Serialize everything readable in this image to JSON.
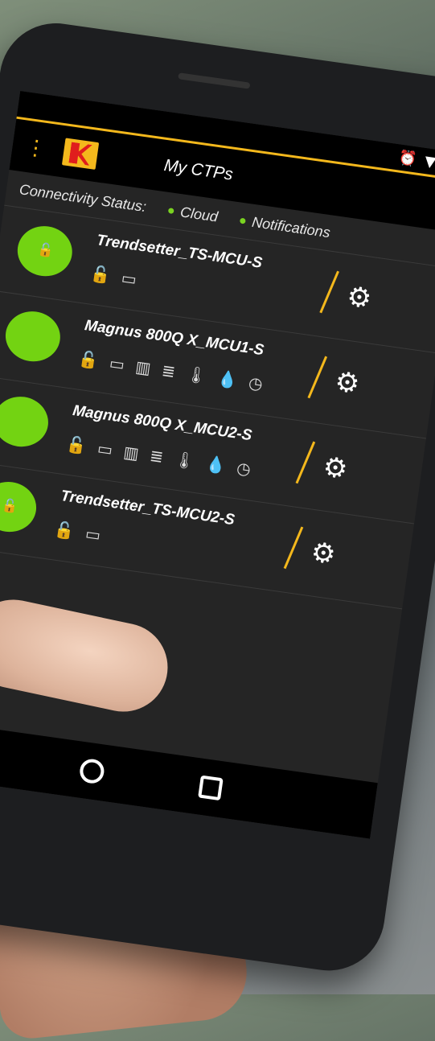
{
  "colors": {
    "accent": "#f4b81c",
    "status_green": "#73d312",
    "alert_red": "#e21b1b",
    "background": "#252525"
  },
  "statusbar": {
    "icons": [
      "alarm-icon",
      "wifi-icon",
      "signal-icon"
    ]
  },
  "appbar": {
    "title": "My CTPs"
  },
  "connectivity": {
    "label": "Connectivity Status:",
    "cloud": "Cloud",
    "notifications": "Notifications"
  },
  "devices": [
    {
      "name": "Trendsetter_TS-MCU-S",
      "icons": [
        "unlock-icon-red",
        "drawer-icon"
      ]
    },
    {
      "name": "Magnus 800Q X_MCU1-S",
      "icons": [
        "unlock-icon",
        "drawer-icon",
        "cassette-icon",
        "plate-stack-icon",
        "thermometer-icon",
        "drop-icon",
        "gauge-icon"
      ]
    },
    {
      "name": "Magnus 800Q X_MCU2-S",
      "icons": [
        "unlock-icon",
        "drawer-icon",
        "cassette-icon",
        "plate-stack-icon",
        "thermometer-icon",
        "drop-icon",
        "gauge-icon"
      ]
    },
    {
      "name": "Trendsetter_TS-MCU2-S",
      "icons": [
        "unlock-icon-red",
        "drawer-icon"
      ]
    }
  ]
}
